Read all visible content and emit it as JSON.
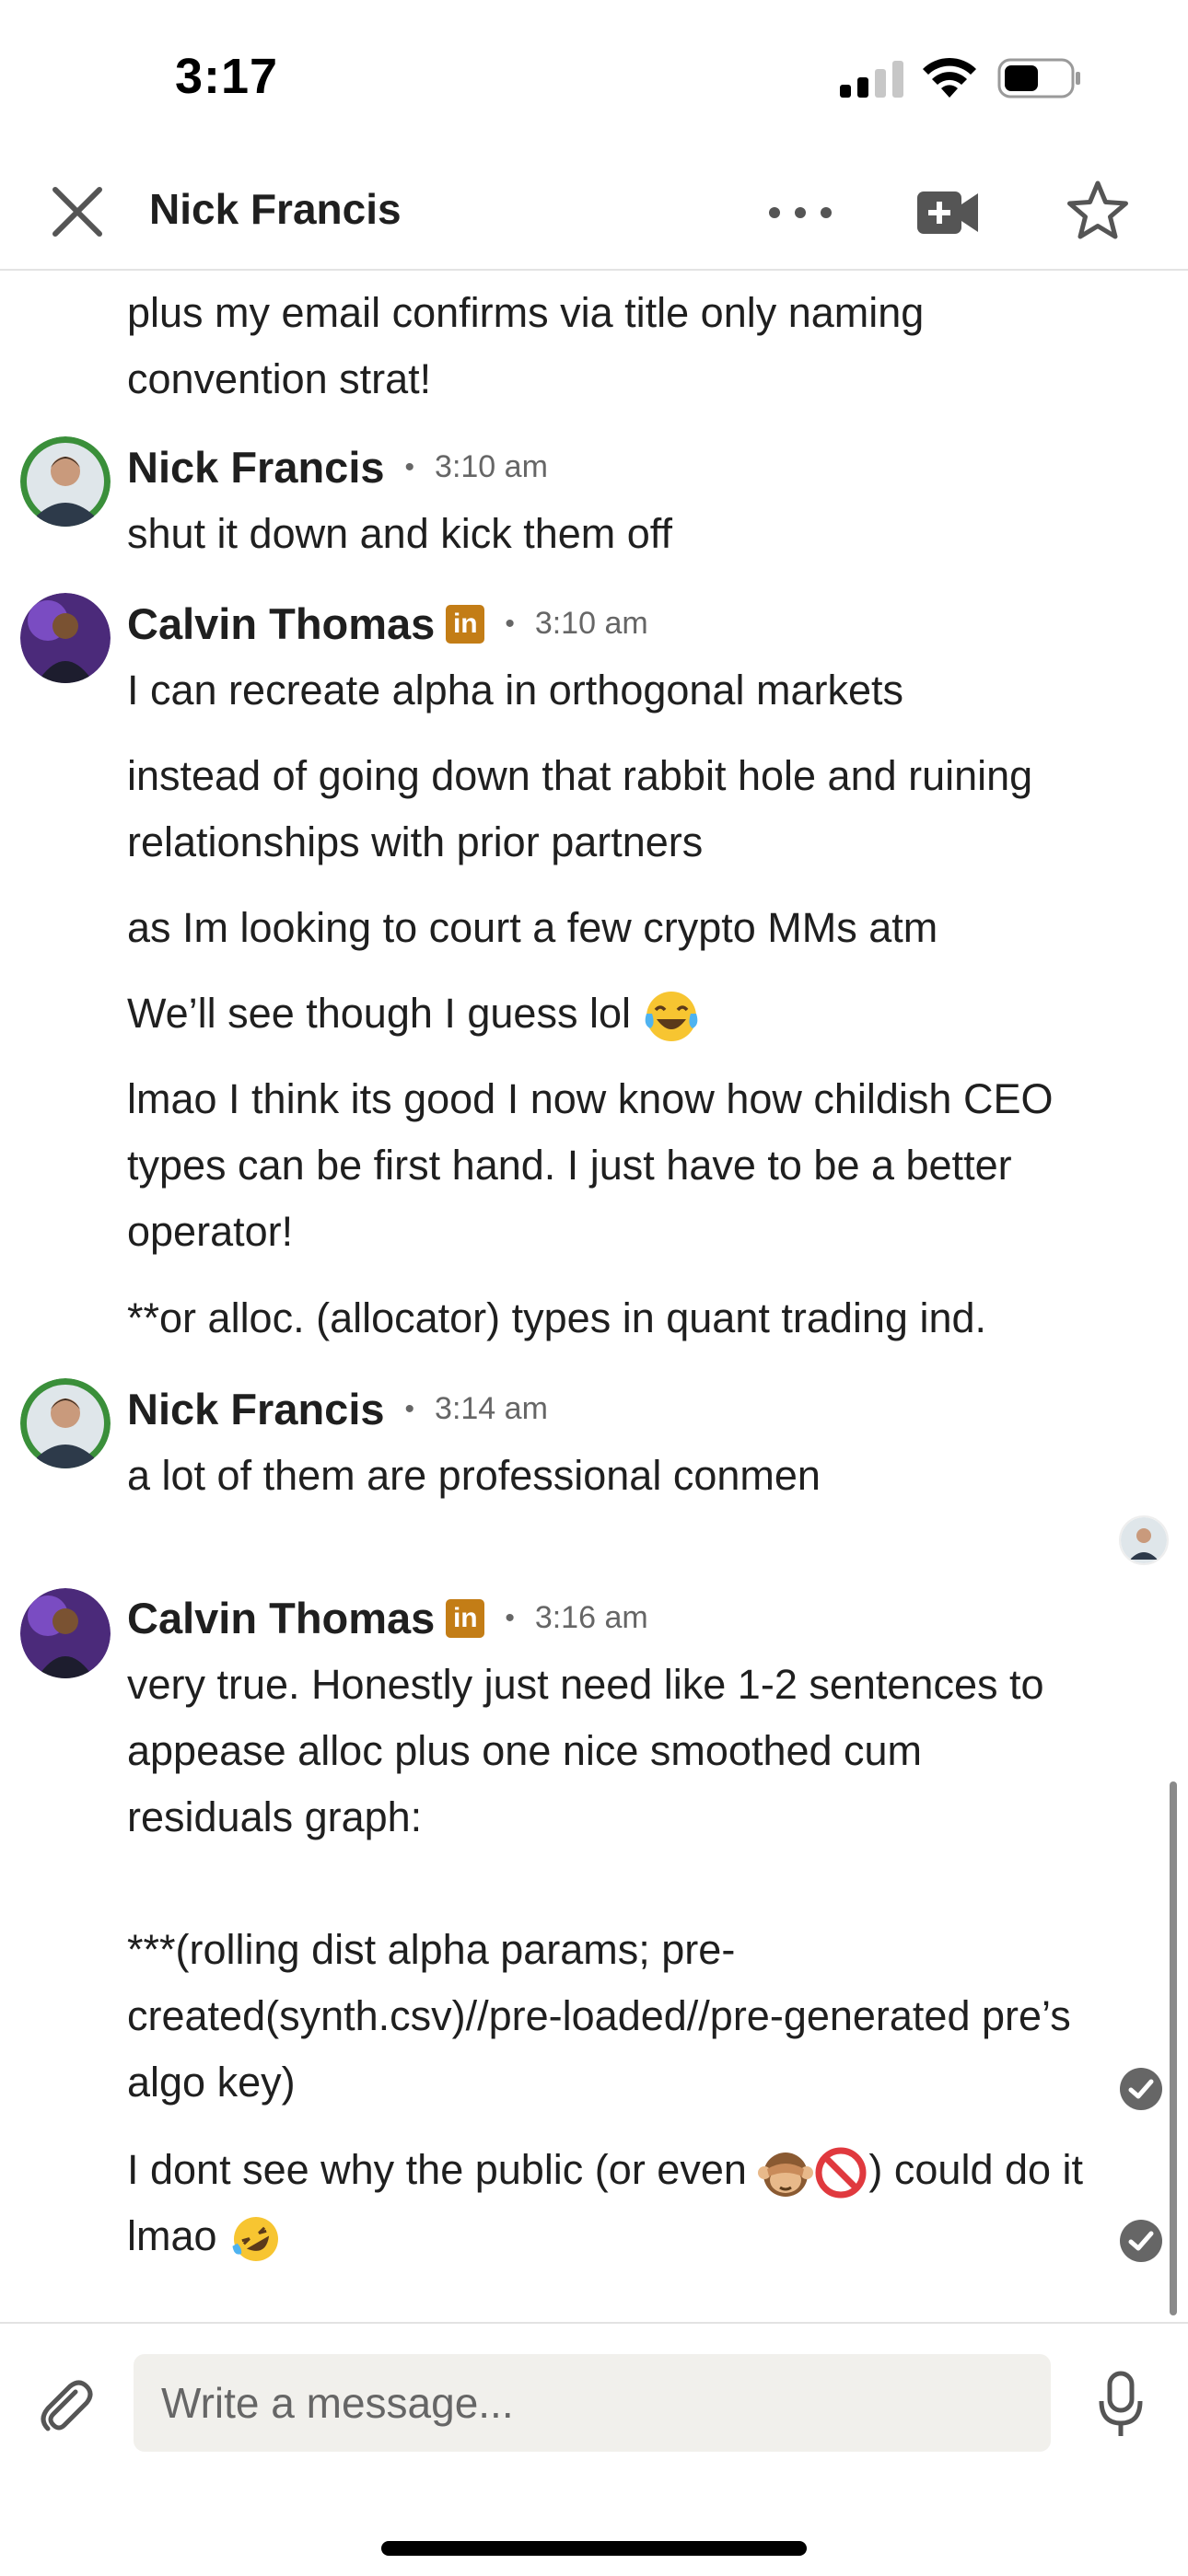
{
  "status_bar": {
    "time": "3:17"
  },
  "header": {
    "title": "Nick Francis"
  },
  "messages": [
    {
      "kind": "continuation",
      "text": "plus my email confirms via title only naming convention strat!"
    },
    {
      "kind": "group",
      "sender": "Nick Francis",
      "time": "3:10 am",
      "texts": [
        "shut it down and kick them off"
      ]
    },
    {
      "kind": "group",
      "sender": "Calvin Thomas",
      "time": "3:10 am",
      "badge": "in",
      "texts": [
        "I can recreate alpha in orthogonal markets",
        "instead of going down that rabbit hole and ruining relationships with prior partners",
        "as Im looking to court a few crypto MMs atm",
        "We’ll see though I guess lol",
        "lmao I think its good I now know how childish CEO types can be first hand. I just have to be a better operator!",
        "**or alloc. (allocator) types in quant trading ind."
      ]
    },
    {
      "kind": "group",
      "sender": "Nick Francis",
      "time": "3:14 am",
      "texts": [
        "a lot of them are professional conmen"
      ]
    },
    {
      "kind": "group",
      "sender": "Calvin Thomas",
      "time": "3:16 am",
      "badge": "in",
      "texts": [
        "very true. Honestly just need like 1-2 sentences to appease alloc plus one nice smoothed cum residuals graph:\n\n***(rolling dist alpha params; pre-created(synth.csv)//pre-loaded//pre-generated pre’s algo key)",
        "I dont see why the public (or even",
        ") could do it lmao"
      ]
    }
  ],
  "composer": {
    "placeholder": "Write a message..."
  },
  "colors": {
    "linkedin_badge": "#c37d16",
    "input_bg": "#f1f0ec",
    "text": "#1f1f1f"
  },
  "icons": [
    "close-icon",
    "more-icon",
    "video-call-icon",
    "star-icon",
    "linkedin-icon",
    "paperclip-icon",
    "microphone-icon",
    "read-check-icon"
  ]
}
